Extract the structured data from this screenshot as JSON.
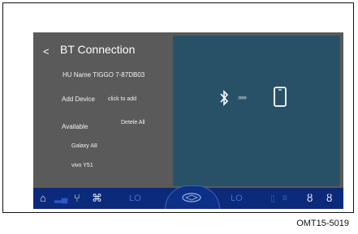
{
  "header": {
    "back_label": "<",
    "title": "BT Connection"
  },
  "list": {
    "hu_name": "HU Name TIGGO 7-87DB03",
    "add_device": "Add Device",
    "click_to_add": "click to add",
    "available": "Available",
    "delete_all": "Detele All",
    "devices": [
      "Galaxy A8",
      "vivo Y51"
    ]
  },
  "status": {
    "left_lo": "LO",
    "right_lo": "LO"
  },
  "caption": "OMT15-5019",
  "colors": {
    "screen_bg": "#5a5a5a",
    "panel_bg": "#285167",
    "bottom_bar": "#0c2a7a"
  },
  "icons": {
    "home": "home-icon",
    "signal": "signal-icon",
    "seat": "seat-icon",
    "fan": "fan-icon",
    "car_logo": "car-logo-icon",
    "bluetooth": "bluetooth-icon",
    "phone": "phone-icon",
    "heat_seat": "seat-heat-icon"
  }
}
